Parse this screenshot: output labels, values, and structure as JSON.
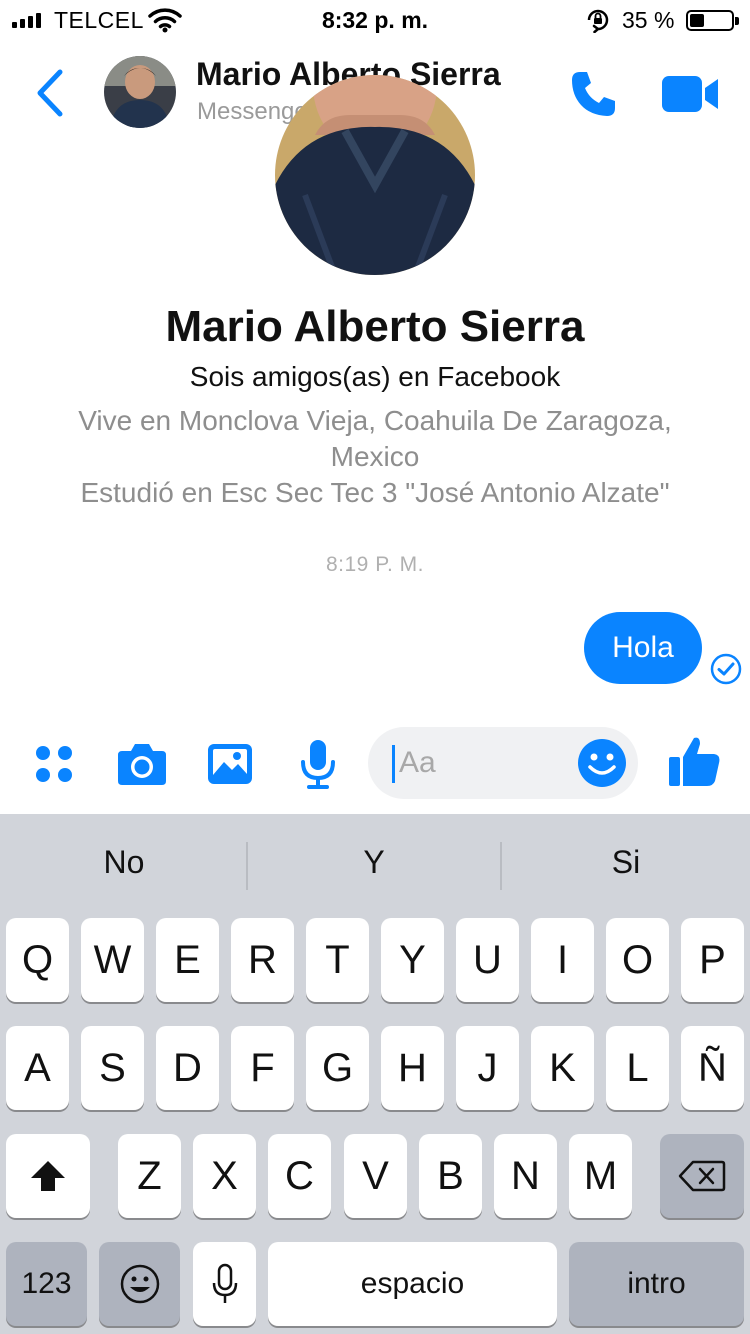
{
  "status_bar": {
    "carrier": "TELCEL",
    "time": "8:32 p. m.",
    "battery_percent": "35 %",
    "battery_level": 0.35
  },
  "header": {
    "contact_name": "Mario Alberto Sierra",
    "subtitle": "Messenger"
  },
  "profile": {
    "name": "Mario Alberto Sierra",
    "friendship": "Sois amigos(as) en Facebook",
    "lives_in": "Vive en Monclova Vieja, Coahuila De Zaragoza, Mexico",
    "studied_at": "Estudió en Esc Sec Tec 3 \"José Antonio Alzate\""
  },
  "conversation": {
    "timestamp": "8:19 P. M.",
    "messages": [
      {
        "text": "Hola",
        "direction": "outgoing",
        "status": "sent"
      }
    ]
  },
  "composer": {
    "placeholder": "Aa"
  },
  "keyboard": {
    "suggestions": [
      "No",
      "Y",
      "Si"
    ],
    "row1": [
      "Q",
      "W",
      "E",
      "R",
      "T",
      "Y",
      "U",
      "I",
      "O",
      "P"
    ],
    "row2": [
      "A",
      "S",
      "D",
      "F",
      "G",
      "H",
      "J",
      "K",
      "L",
      "Ñ"
    ],
    "row3": [
      "Z",
      "X",
      "C",
      "V",
      "B",
      "N",
      "M"
    ],
    "numbers_label": "123",
    "space_label": "espacio",
    "return_label": "intro"
  },
  "colors": {
    "accent": "#0a84ff",
    "keyboard_bg": "#d1d4da",
    "dark_key": "#aeb3be"
  }
}
